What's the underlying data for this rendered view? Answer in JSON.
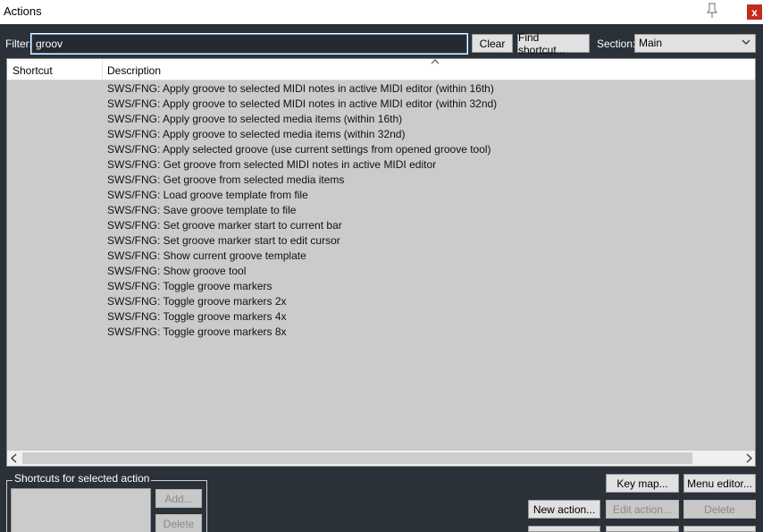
{
  "window": {
    "title": "Actions"
  },
  "filter": {
    "label": "Filter:",
    "value": "groov"
  },
  "buttons": {
    "clear": "Clear",
    "find_shortcut": "Find shortcut...",
    "key_map": "Key map...",
    "menu_editor": "Menu editor...",
    "new_action": "New action...",
    "edit_action": "Edit action...",
    "delete_action": "Delete",
    "add_shortcut": "Add...",
    "delete_shortcut": "Delete"
  },
  "section": {
    "label": "Section:",
    "value": "Main"
  },
  "list": {
    "columns": {
      "shortcut": "Shortcut",
      "description": "Description"
    },
    "rows": [
      "SWS/FNG: Apply groove to selected MIDI notes in active MIDI editor (within 16th)",
      "SWS/FNG: Apply groove to selected MIDI notes in active MIDI editor (within 32nd)",
      "SWS/FNG: Apply groove to selected media items (within 16th)",
      "SWS/FNG: Apply groove to selected media items (within 32nd)",
      "SWS/FNG: Apply selected groove (use current settings from opened groove tool)",
      "SWS/FNG: Get groove from selected MIDI notes in active MIDI editor",
      "SWS/FNG: Get groove from selected media items",
      "SWS/FNG: Load groove template from file",
      "SWS/FNG: Save groove template to file",
      "SWS/FNG: Set groove marker start to current bar",
      "SWS/FNG: Set groove marker start to edit cursor",
      "SWS/FNG: Show current groove template",
      "SWS/FNG: Show groove tool",
      "SWS/FNG: Toggle groove markers",
      "SWS/FNG: Toggle groove markers 2x",
      "SWS/FNG: Toggle groove markers 4x",
      "SWS/FNG: Toggle groove markers 8x"
    ]
  },
  "shortcuts_group": {
    "title": "Shortcuts for selected action"
  },
  "close_glyph": "x",
  "colors": {
    "background": "#2b3139",
    "list_bg": "#cbcbcb",
    "close": "#c42b1c",
    "focus": "#5a9ad6"
  }
}
